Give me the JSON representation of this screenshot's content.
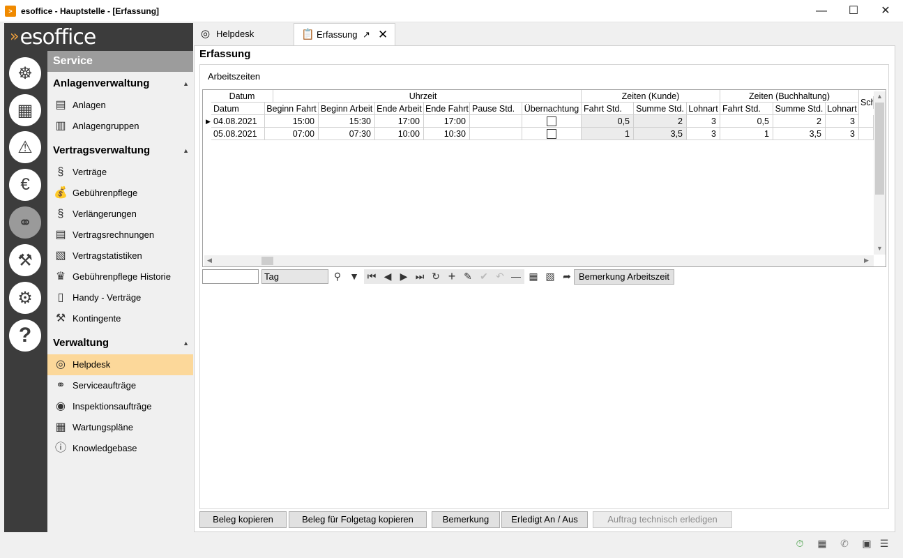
{
  "window": {
    "title": "esoffice - Hauptstelle - [Erfassung]",
    "minimize_icon": "minimize-icon",
    "maximize_icon": "maximize-icon",
    "close_icon": "close-icon"
  },
  "brand": {
    "logo_text": "esoffice"
  },
  "rail": {
    "icons": [
      "helm-icon",
      "maze-icon",
      "alarm-light-icon",
      "money-icon",
      "headset-icon",
      "tools-icon",
      "gears-icon",
      "help-icon"
    ],
    "active_index": 4
  },
  "sidebar": {
    "header": "Service",
    "groups": [
      {
        "label": "Anlagenverwaltung"
      },
      {
        "label": "Vertragsverwaltung"
      },
      {
        "label": "Verwaltung"
      }
    ],
    "items": [
      {
        "label": "Anlagen",
        "icon": "factory-icon"
      },
      {
        "label": "Anlagengruppen",
        "icon": "factory-group-icon"
      },
      {
        "label": "Verträge",
        "icon": "paragraph-icon"
      },
      {
        "label": "Gebührenpflege",
        "icon": "money-bag-icon"
      },
      {
        "label": "Verlängerungen",
        "icon": "paragraph-clock-icon"
      },
      {
        "label": "Vertragsrechnungen",
        "icon": "invoice-icon"
      },
      {
        "label": "Vertragstatistiken",
        "icon": "statistics-icon"
      },
      {
        "label": "Gebührenpflege Historie",
        "icon": "money-bag-history-icon"
      },
      {
        "label": "Handy - Verträge",
        "icon": "phone-icon"
      },
      {
        "label": "Kontingente",
        "icon": "tools-icon"
      },
      {
        "label": "Helpdesk",
        "icon": "lifebuoy-icon",
        "selected": true
      },
      {
        "label": "Serviceaufträge",
        "icon": "headset-icon"
      },
      {
        "label": "Inspektionsaufträge",
        "icon": "eye-icon"
      },
      {
        "label": "Wartungspläne",
        "icon": "calendar-icon"
      },
      {
        "label": "Knowledgebase",
        "icon": "info-book-icon"
      }
    ]
  },
  "tabs": [
    {
      "label": "Helpdesk",
      "icon": "lifebuoy-icon"
    },
    {
      "label": "Erfassung",
      "icon": "clipboard-icon",
      "active": true
    }
  ],
  "main": {
    "title": "Erfassung",
    "section_label": "Arbeitszeiten",
    "grid": {
      "band_headers": [
        "Datum",
        "Uhrzeit",
        "Zeiten (Kunde)",
        "Zeiten (Buchhaltung)",
        "Sch"
      ],
      "columns": [
        "Datum",
        "Beginn Fahrt",
        "Beginn Arbeit",
        "Ende Arbeit",
        "Ende Fahrt",
        "Pause Std.",
        "Übernachtung",
        "Fahrt Std.",
        "Summe Std.",
        "Lohnart",
        "Fahrt Std.",
        "Summe Std.",
        "Lohnart"
      ],
      "rows": [
        {
          "datum": "04.08.2021",
          "beginn_fahrt": "15:00",
          "beginn_arbeit": "15:30",
          "ende_arbeit": "17:00",
          "ende_fahrt": "17:00",
          "pause": "",
          "uebernachtung": false,
          "k_fahrt": "0,5",
          "k_summe": "2",
          "k_lohnart": "3",
          "b_fahrt": "0,5",
          "b_summe": "2",
          "b_lohnart": "3"
        },
        {
          "datum": "05.08.2021",
          "beginn_fahrt": "07:00",
          "beginn_arbeit": "07:30",
          "ende_arbeit": "10:00",
          "ende_fahrt": "10:30",
          "pause": "",
          "uebernachtung": false,
          "k_fahrt": "1",
          "k_summe": "3,5",
          "k_lohnart": "3",
          "b_fahrt": "1",
          "b_summe": "3,5",
          "b_lohnart": "3"
        }
      ]
    },
    "navigator": {
      "search_value": "",
      "period_value": "Tag",
      "remark_button": "Bemerkung Arbeitszeit"
    }
  },
  "footer_buttons": [
    {
      "label": "Beleg kopieren",
      "enabled": true
    },
    {
      "label": "Beleg für Folgetag kopieren",
      "enabled": true
    },
    {
      "label": "Bemerkung",
      "enabled": true
    },
    {
      "label": "Erledigt An / Aus",
      "enabled": true
    },
    {
      "label": "Auftrag technisch erledigen",
      "enabled": false
    }
  ],
  "statusbar": {
    "icons": [
      "stopwatch-icon",
      "building-icon",
      "phone-icon",
      "lock-icon",
      "database-icon"
    ]
  },
  "colors": {
    "rail": "#3c3c3c",
    "accent": "#f0a03c",
    "selected_item": "#fcd89a",
    "section_header": "#9c9c9c"
  }
}
